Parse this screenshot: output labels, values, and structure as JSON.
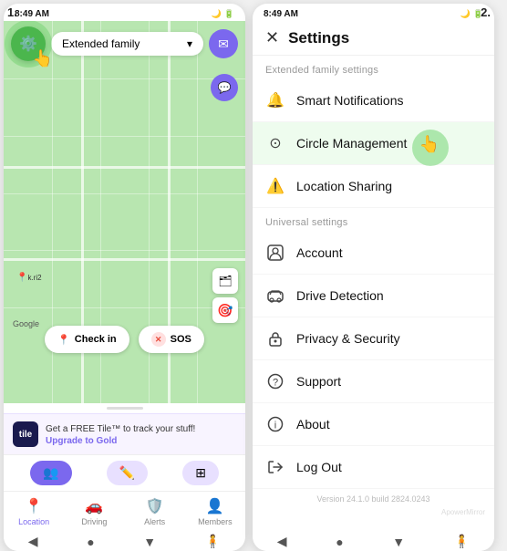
{
  "screen1": {
    "step": "1.",
    "status_time": "8:49 AM",
    "family_picker": "Extended family",
    "check_in_label": "Check in",
    "sos_label": "SOS",
    "promo_text": "Get a FREE Tile™ to track your stuff!",
    "promo_upgrade": "Upgrade to Gold",
    "tabs": [
      {
        "label": "Location",
        "icon": "📍"
      },
      {
        "label": "Driving",
        "icon": "🚗"
      },
      {
        "label": "Alerts",
        "icon": "🛡️"
      },
      {
        "label": "Members",
        "icon": "👤"
      }
    ],
    "google_label": "Google"
  },
  "screen2": {
    "step": "2.",
    "status_time": "8:49 AM",
    "title": "Settings",
    "section1_label": "Extended family settings",
    "section2_label": "Universal settings",
    "menu_items_section1": [
      {
        "label": "Smart Notifications",
        "icon": "🔔"
      },
      {
        "label": "Circle Management",
        "icon": "⊙"
      },
      {
        "label": "Location Sharing",
        "icon": "⚠️"
      }
    ],
    "menu_items_section2": [
      {
        "label": "Account",
        "icon": "👤"
      },
      {
        "label": "Drive Detection",
        "icon": "🚗"
      },
      {
        "label": "Privacy & Security",
        "icon": "🔒"
      },
      {
        "label": "Support",
        "icon": "❓"
      },
      {
        "label": "About",
        "icon": "ℹ️"
      },
      {
        "label": "Log Out",
        "icon": "⬡"
      }
    ],
    "version": "Version 24.1.0 build 2824.0243"
  }
}
